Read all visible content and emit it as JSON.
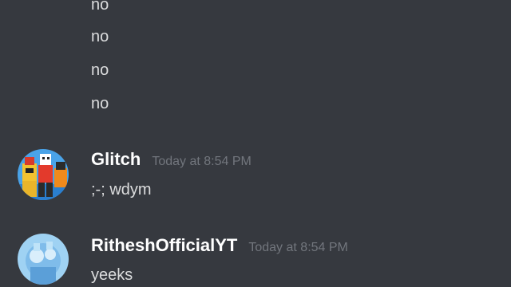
{
  "continuation_messages": [
    "no",
    "no",
    "no",
    "no"
  ],
  "messages": [
    {
      "username": "Glitch",
      "timestamp": "Today at 8:54 PM",
      "text": ";-; wdym",
      "avatar_icon": "robot-avatar-icon"
    },
    {
      "username": "RitheshOfficialYT",
      "timestamp": "Today at 8:54 PM",
      "text": "yeeks",
      "avatar_icon": "blue-character-avatar-icon"
    }
  ],
  "colors": {
    "background": "#36393f",
    "message_text": "#dcddde",
    "username": "#ffffff",
    "timestamp": "#72767d"
  }
}
